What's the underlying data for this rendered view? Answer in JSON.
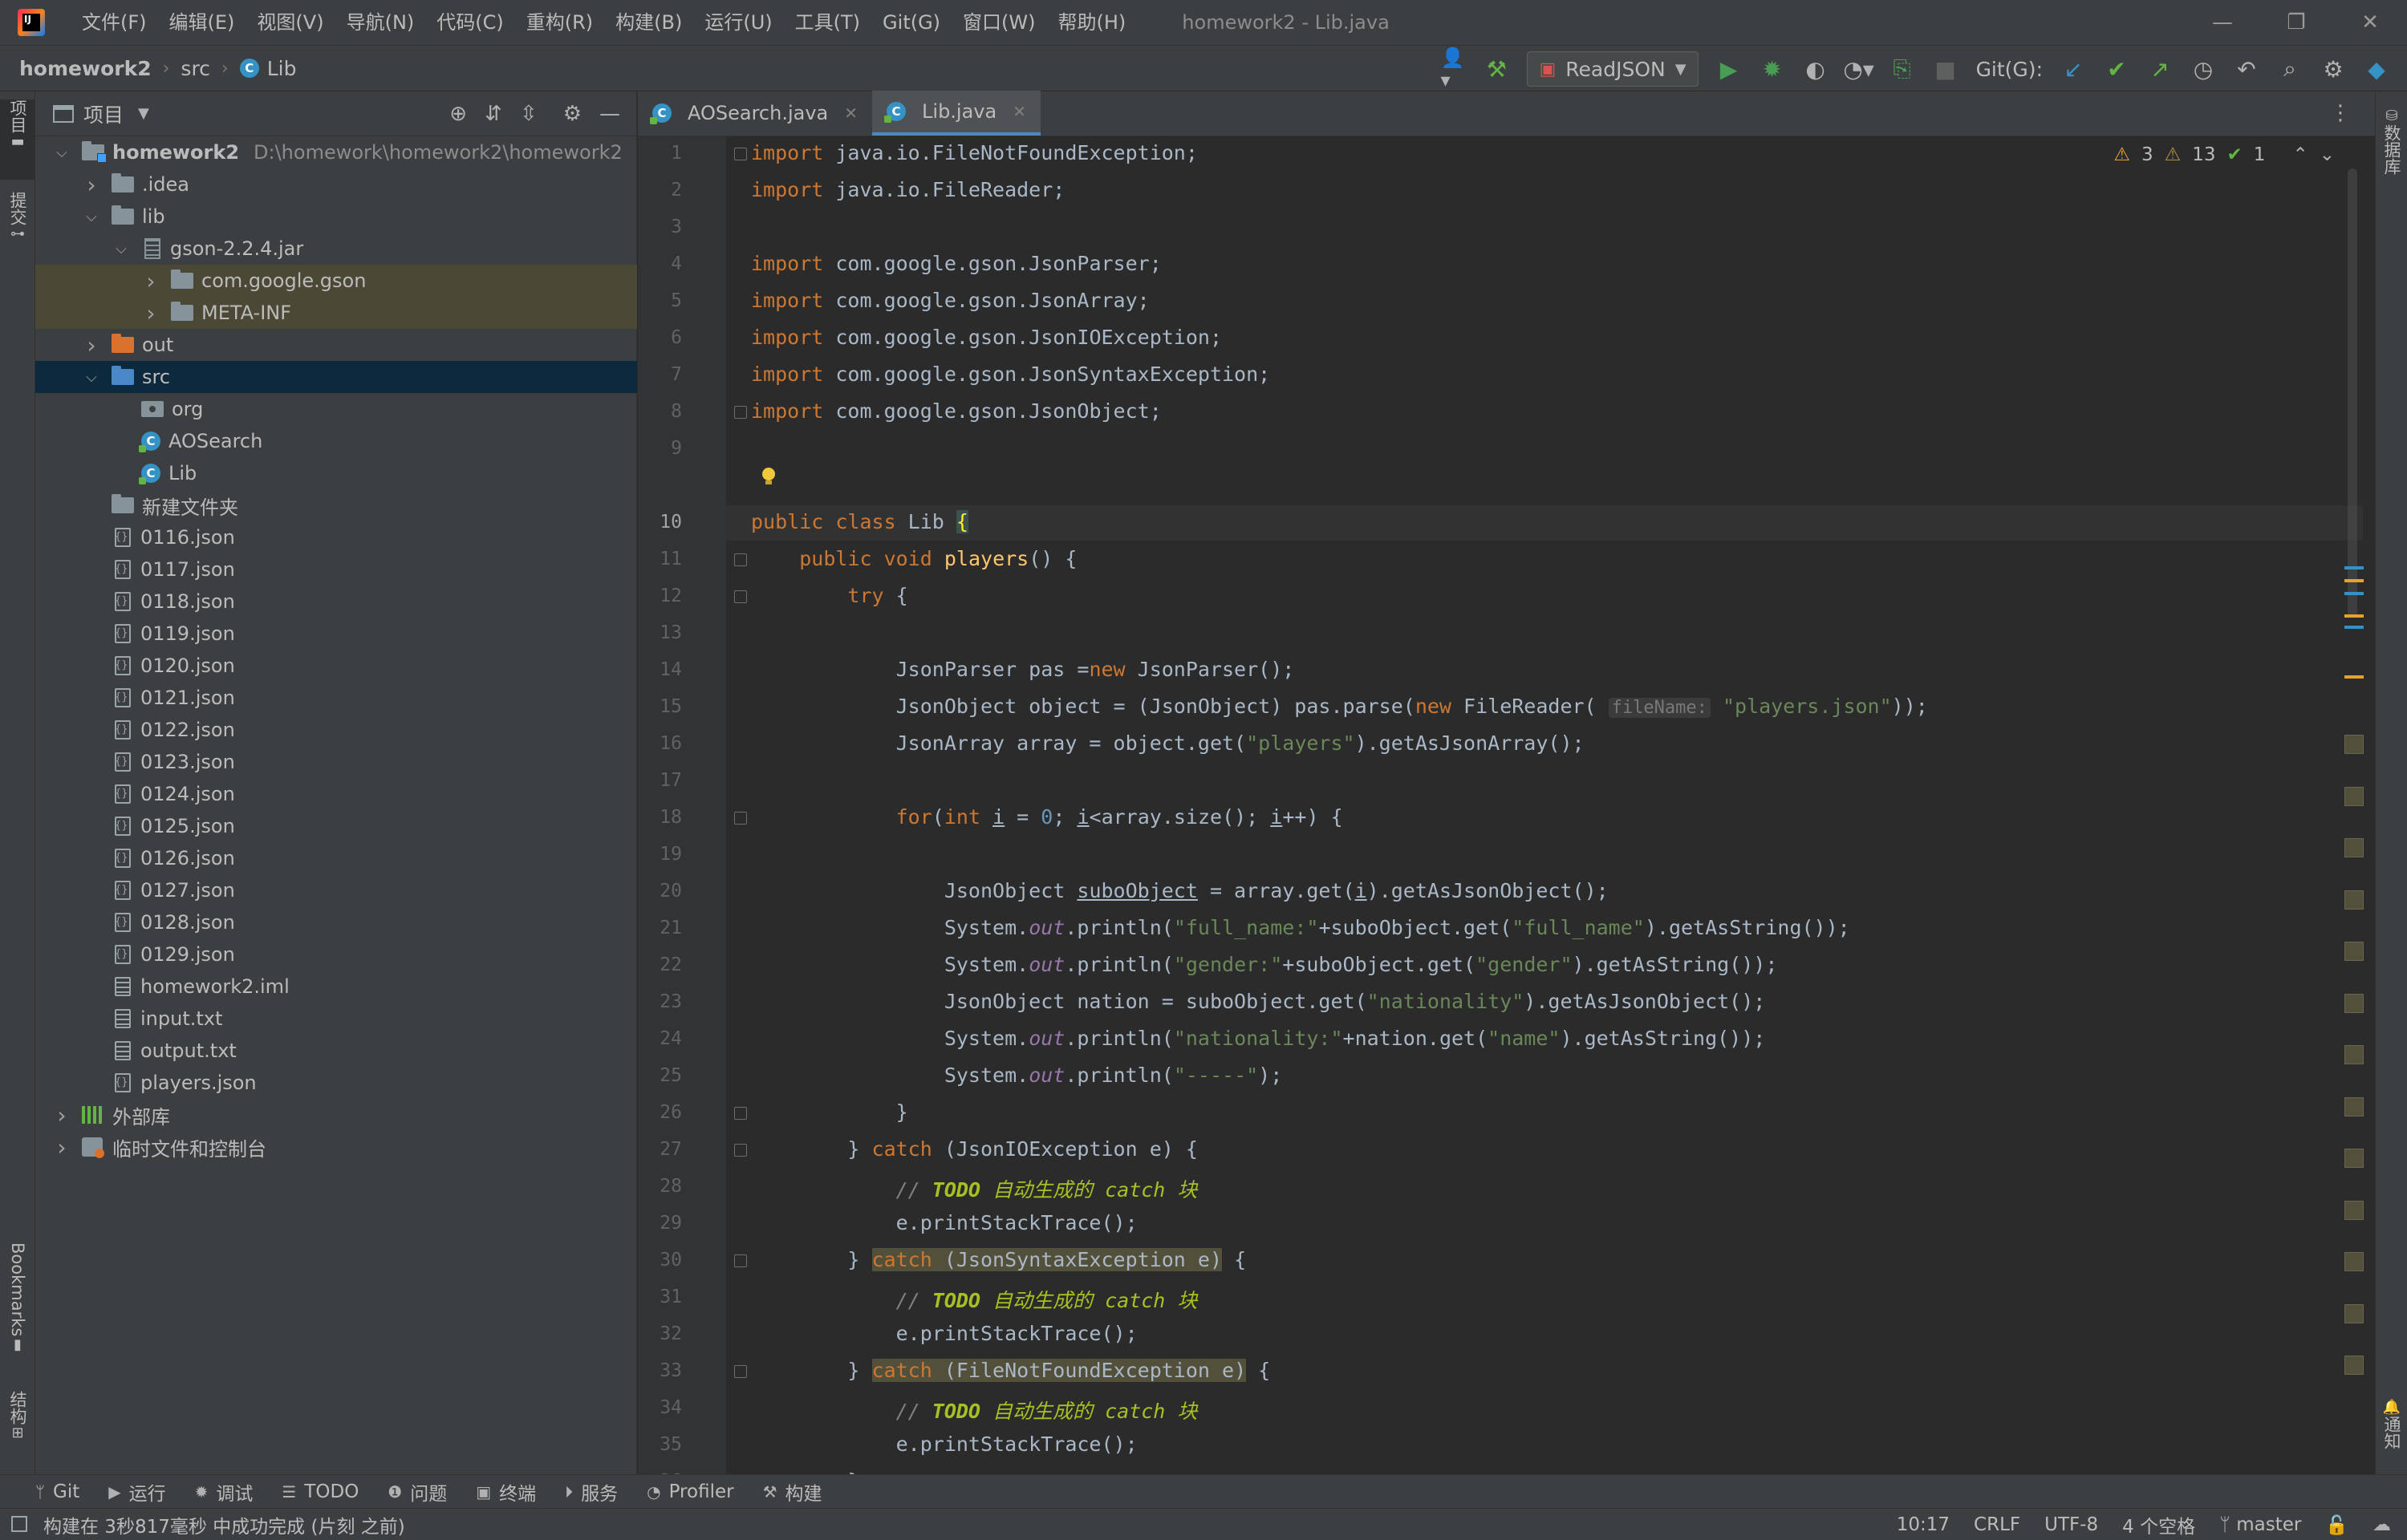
{
  "window": {
    "title": "homework2 - Lib.java",
    "menu": [
      "文件(F)",
      "编辑(E)",
      "视图(V)",
      "导航(N)",
      "代码(C)",
      "重构(R)",
      "构建(B)",
      "运行(U)",
      "工具(T)",
      "Git(G)",
      "窗口(W)",
      "帮助(H)"
    ],
    "controls": {
      "minimize": "—",
      "restore": "❐",
      "close": "✕"
    }
  },
  "breadcrumb": {
    "project": "homework2",
    "folder": "src",
    "file": "Lib"
  },
  "toolbar": {
    "run_config": "ReadJSON",
    "git_label": "Git(G):"
  },
  "left_strip": {
    "project_tab": "项目",
    "commit_tab": "提交",
    "bookmarks_tab": "Bookmarks",
    "structure_tab": "结构"
  },
  "right_strip": {
    "database_tab": "数据库",
    "notifications_tab": "通知"
  },
  "project_panel": {
    "title": "项目",
    "tree": [
      {
        "label": "homework2",
        "path": "D:\\homework\\homework2\\homework2",
        "depth": 0,
        "arrow": "open",
        "icon": "module",
        "bold": true
      },
      {
        "label": ".idea",
        "depth": 1,
        "arrow": "closed",
        "icon": "folder"
      },
      {
        "label": "lib",
        "depth": 1,
        "arrow": "open",
        "icon": "folder"
      },
      {
        "label": "gson-2.2.4.jar",
        "depth": 2,
        "arrow": "open",
        "icon": "jar"
      },
      {
        "label": "com.google.gson",
        "depth": 3,
        "arrow": "closed",
        "icon": "folder",
        "highlight": "lib"
      },
      {
        "label": "META-INF",
        "depth": 3,
        "arrow": "closed",
        "icon": "folder",
        "highlight": "lib"
      },
      {
        "label": "out",
        "depth": 1,
        "arrow": "closed",
        "icon": "folder-orange"
      },
      {
        "label": "src",
        "depth": 1,
        "arrow": "open",
        "icon": "folder-blue",
        "highlight": "selected"
      },
      {
        "label": "org",
        "depth": 2,
        "arrow": "none",
        "icon": "package"
      },
      {
        "label": "AOSearch",
        "depth": 2,
        "arrow": "none",
        "icon": "class"
      },
      {
        "label": "Lib",
        "depth": 2,
        "arrow": "none",
        "icon": "class"
      },
      {
        "label": "新建文件夹",
        "depth": 1,
        "arrow": "none",
        "icon": "folder"
      },
      {
        "label": "0116.json",
        "depth": 1,
        "arrow": "none",
        "icon": "json"
      },
      {
        "label": "0117.json",
        "depth": 1,
        "arrow": "none",
        "icon": "json"
      },
      {
        "label": "0118.json",
        "depth": 1,
        "arrow": "none",
        "icon": "json"
      },
      {
        "label": "0119.json",
        "depth": 1,
        "arrow": "none",
        "icon": "json"
      },
      {
        "label": "0120.json",
        "depth": 1,
        "arrow": "none",
        "icon": "json"
      },
      {
        "label": "0121.json",
        "depth": 1,
        "arrow": "none",
        "icon": "json"
      },
      {
        "label": "0122.json",
        "depth": 1,
        "arrow": "none",
        "icon": "json"
      },
      {
        "label": "0123.json",
        "depth": 1,
        "arrow": "none",
        "icon": "json"
      },
      {
        "label": "0124.json",
        "depth": 1,
        "arrow": "none",
        "icon": "json"
      },
      {
        "label": "0125.json",
        "depth": 1,
        "arrow": "none",
        "icon": "json"
      },
      {
        "label": "0126.json",
        "depth": 1,
        "arrow": "none",
        "icon": "json"
      },
      {
        "label": "0127.json",
        "depth": 1,
        "arrow": "none",
        "icon": "json"
      },
      {
        "label": "0128.json",
        "depth": 1,
        "arrow": "none",
        "icon": "json"
      },
      {
        "label": "0129.json",
        "depth": 1,
        "arrow": "none",
        "icon": "json"
      },
      {
        "label": "homework2.iml",
        "depth": 1,
        "arrow": "none",
        "icon": "txt"
      },
      {
        "label": "input.txt",
        "depth": 1,
        "arrow": "none",
        "icon": "txt"
      },
      {
        "label": "output.txt",
        "depth": 1,
        "arrow": "none",
        "icon": "txt"
      },
      {
        "label": "players.json",
        "depth": 1,
        "arrow": "none",
        "icon": "json"
      },
      {
        "label": "外部库",
        "depth": 0,
        "arrow": "closed",
        "icon": "library"
      },
      {
        "label": "临时文件和控制台",
        "depth": 0,
        "arrow": "closed",
        "icon": "scratch"
      }
    ]
  },
  "editor": {
    "tabs": [
      {
        "label": "AOSearch.java",
        "active": false
      },
      {
        "label": "Lib.java",
        "active": true
      }
    ],
    "inspection": {
      "warnings": "3",
      "weak_warnings": "13",
      "typos": "1"
    },
    "current_line": "10",
    "lines": [
      {
        "n": "1",
        "html": "<span class=\"kw\">import</span> java.io.FileNotFoundException;"
      },
      {
        "n": "2",
        "html": "<span class=\"kw\">import</span> java.io.FileReader;"
      },
      {
        "n": "3",
        "html": ""
      },
      {
        "n": "4",
        "html": "<span class=\"kw\">import</span> com.google.gson.JsonParser;"
      },
      {
        "n": "5",
        "html": "<span class=\"kw\">import</span> com.google.gson.JsonArray;"
      },
      {
        "n": "6",
        "html": "<span class=\"kw\">import</span> com.google.gson.JsonIOException;"
      },
      {
        "n": "7",
        "html": "<span class=\"kw\">import</span> com.google.gson.JsonSyntaxException;"
      },
      {
        "n": "8",
        "html": "<span class=\"kw\">import</span> com.google.gson.JsonObject;"
      },
      {
        "n": "9",
        "html": ""
      },
      {
        "n": "10",
        "html": "<span class=\"kw\">public class</span> Lib <span class=\"brace-hl\">{</span>"
      },
      {
        "n": "11",
        "html": "    <span class=\"kw\">public void</span> <span class=\"fn\">players</span>() {"
      },
      {
        "n": "12",
        "html": "        <span class=\"kw\">try</span> {"
      },
      {
        "n": "13",
        "html": ""
      },
      {
        "n": "14",
        "html": "            JsonParser pas =<span class=\"kw\">new</span> JsonParser();"
      },
      {
        "n": "15",
        "html": "            JsonObject object = (JsonObject) pas.parse(<span class=\"kw\">new</span> FileReader( <span class=\"hint\">fileName:</span> <span class=\"str\">\"players.json\"</span>));"
      },
      {
        "n": "16",
        "html": "            JsonArray array = object.get(<span class=\"str\">\"players\"</span>).getAsJsonArray();"
      },
      {
        "n": "17",
        "html": ""
      },
      {
        "n": "18",
        "html": "            <span class=\"kw\">for</span>(<span class=\"kw\">int</span> <span class=\"ul\">i</span> = <span class=\"num\">0</span>; <span class=\"ul\">i</span>&lt;array.size(); <span class=\"ul\">i</span>++) {"
      },
      {
        "n": "19",
        "html": ""
      },
      {
        "n": "20",
        "html": "                JsonObject <span class=\"ul\">suboObject</span> = array.get(<span class=\"ul\">i</span>).getAsJsonObject();"
      },
      {
        "n": "21",
        "html": "                System.<span class=\"field\">out</span>.println(<span class=\"str\">\"full_name:\"</span>+suboObject.get(<span class=\"str\">\"full_name\"</span>).getAsString());"
      },
      {
        "n": "22",
        "html": "                System.<span class=\"field\">out</span>.println(<span class=\"str\">\"gender:\"</span>+suboObject.get(<span class=\"str\">\"gender\"</span>).getAsString());"
      },
      {
        "n": "23",
        "html": "                JsonObject nation = suboObject.get(<span class=\"str\">\"nationality\"</span>).getAsJsonObject();"
      },
      {
        "n": "24",
        "html": "                System.<span class=\"field\">out</span>.println(<span class=\"str\">\"nationality:\"</span>+nation.get(<span class=\"str\">\"name\"</span>).getAsString());"
      },
      {
        "n": "25",
        "html": "                System.<span class=\"field\">out</span>.println(<span class=\"str\">\"-----\"</span>);"
      },
      {
        "n": "26",
        "html": "            }"
      },
      {
        "n": "27",
        "html": "        } <span class=\"kw\">catch</span> (JsonIOException e) {"
      },
      {
        "n": "28",
        "html": "            <span class=\"cmt\">// </span><span class=\"todo\">TODO</span><span class=\"todo-text\"> 自动生成的 catch 块</span>"
      },
      {
        "n": "29",
        "html": "            e.printStackTrace();"
      },
      {
        "n": "30",
        "html": "        } <span class=\"kw warn-hl\">catch</span><span class=\"warn-hl\"> (JsonSyntaxException e)</span> {"
      },
      {
        "n": "31",
        "html": "            <span class=\"cmt\">// </span><span class=\"todo\">TODO</span><span class=\"todo-text\"> 自动生成的 catch 块</span>"
      },
      {
        "n": "32",
        "html": "            e.printStackTrace();"
      },
      {
        "n": "33",
        "html": "        } <span class=\"kw warn-hl\">catch</span><span class=\"warn-hl\"> (FileNotFoundException e)</span> {"
      },
      {
        "n": "34",
        "html": "            <span class=\"cmt\">// </span><span class=\"todo\">TODO</span><span class=\"todo-text\"> 自动生成的 catch 块</span>"
      },
      {
        "n": "35",
        "html": "            e.printStackTrace();"
      },
      {
        "n": "36",
        "html": "        }"
      }
    ]
  },
  "bottom_tools": [
    {
      "label": "Git",
      "icon": "git-branch-icon",
      "glyph": "ᛘ"
    },
    {
      "label": "运行",
      "icon": "run-icon",
      "glyph": "▶"
    },
    {
      "label": "调试",
      "icon": "debug-icon",
      "glyph": "✹"
    },
    {
      "label": "TODO",
      "icon": "todo-icon",
      "glyph": "☰"
    },
    {
      "label": "问题",
      "icon": "problems-icon",
      "glyph": "❶"
    },
    {
      "label": "终端",
      "icon": "terminal-icon",
      "glyph": "▣"
    },
    {
      "label": "服务",
      "icon": "services-icon",
      "glyph": "⏵"
    },
    {
      "label": "Profiler",
      "icon": "profiler-icon",
      "glyph": "◔"
    },
    {
      "label": "构建",
      "icon": "build-icon",
      "glyph": "⚒"
    }
  ],
  "statusbar": {
    "message": "构建在 3秒817毫秒 中成功完成 (片刻 之前)",
    "position": "10:17",
    "line_ending": "CRLF",
    "encoding": "UTF-8",
    "indent": "4 个空格",
    "branch": "master"
  },
  "colors": {
    "keyword": "#cc7832",
    "string": "#6a8759",
    "number": "#6897bb",
    "method": "#ffc66d",
    "accent": "#4a88c7"
  }
}
